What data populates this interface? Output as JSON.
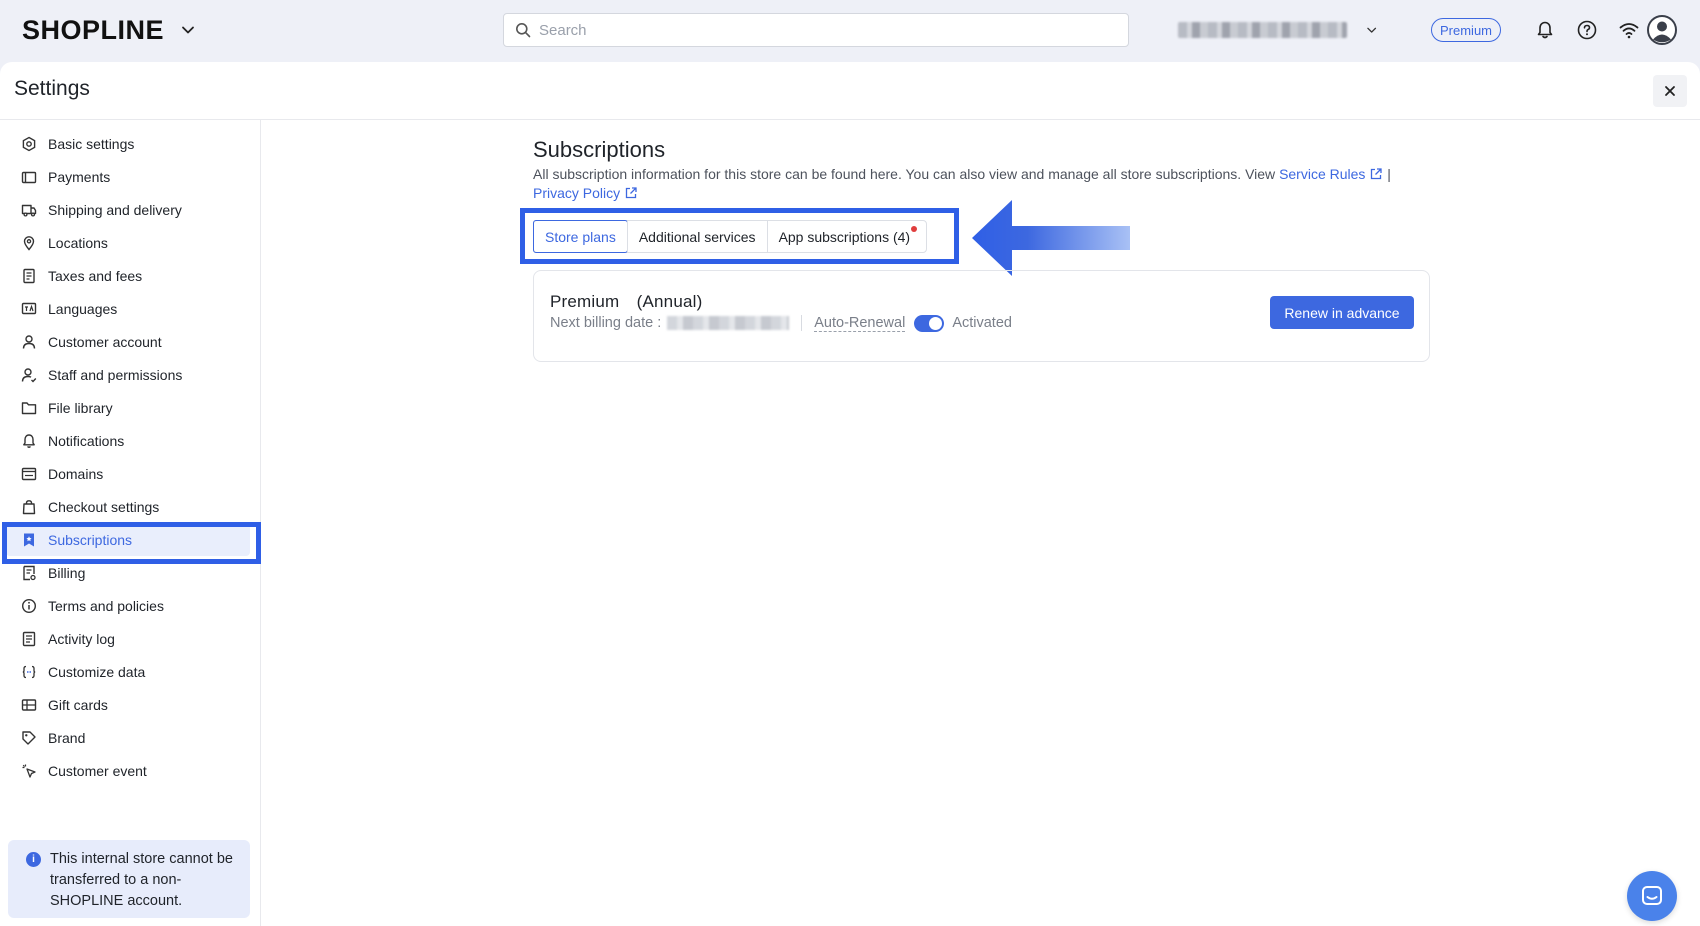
{
  "topbar": {
    "logo": "SHOPLINE",
    "search_placeholder": "Search",
    "plan_badge": "Premium"
  },
  "panel": {
    "title": "Settings"
  },
  "sidebar": {
    "items": [
      {
        "label": "Basic settings",
        "icon": "gear-hex-icon"
      },
      {
        "label": "Payments",
        "icon": "wallet-icon"
      },
      {
        "label": "Shipping and delivery",
        "icon": "truck-icon"
      },
      {
        "label": "Locations",
        "icon": "location-pin-icon"
      },
      {
        "label": "Taxes and fees",
        "icon": "receipt-icon"
      },
      {
        "label": "Languages",
        "icon": "language-icon"
      },
      {
        "label": "Customer account",
        "icon": "person-icon"
      },
      {
        "label": "Staff and permissions",
        "icon": "staff-icon"
      },
      {
        "label": "File library",
        "icon": "folder-icon"
      },
      {
        "label": "Notifications",
        "icon": "bell-icon"
      },
      {
        "label": "Domains",
        "icon": "domain-icon"
      },
      {
        "label": "Checkout settings",
        "icon": "bag-icon"
      },
      {
        "label": "Subscriptions",
        "icon": "bookmark-star-icon",
        "active": true
      },
      {
        "label": "Billing",
        "icon": "bill-icon"
      },
      {
        "label": "Terms and policies",
        "icon": "info-circle-icon"
      },
      {
        "label": "Activity log",
        "icon": "log-icon"
      },
      {
        "label": "Customize data",
        "icon": "braces-icon"
      },
      {
        "label": "Gift cards",
        "icon": "gift-card-icon"
      },
      {
        "label": "Brand",
        "icon": "brand-icon"
      },
      {
        "label": "Customer event",
        "icon": "cursor-click-icon"
      }
    ],
    "notice": "This internal store cannot be transferred to a non-SHOPLINE account."
  },
  "main": {
    "title": "Subscriptions",
    "description": "All subscription information for this store can be found here. You can also view and manage all store subscriptions. View",
    "service_rules_link": "Service Rules",
    "divider": "|",
    "privacy_policy_link": "Privacy Policy",
    "tabs": [
      {
        "label": "Store plans",
        "active": true
      },
      {
        "label": "Additional services"
      },
      {
        "label": "App subscriptions (4)",
        "has_dot": true
      }
    ],
    "plan": {
      "name": "Premium　(Annual)",
      "billing_label": "Next billing date :",
      "auto_renewal_label": "Auto-Renewal",
      "auto_renewal_on": true,
      "status": "Activated",
      "renew_button": "Renew in advance"
    }
  },
  "colors": {
    "accent": "#3d68e0",
    "highlight": "#2f5fe6",
    "chat": "#4a82ea"
  }
}
